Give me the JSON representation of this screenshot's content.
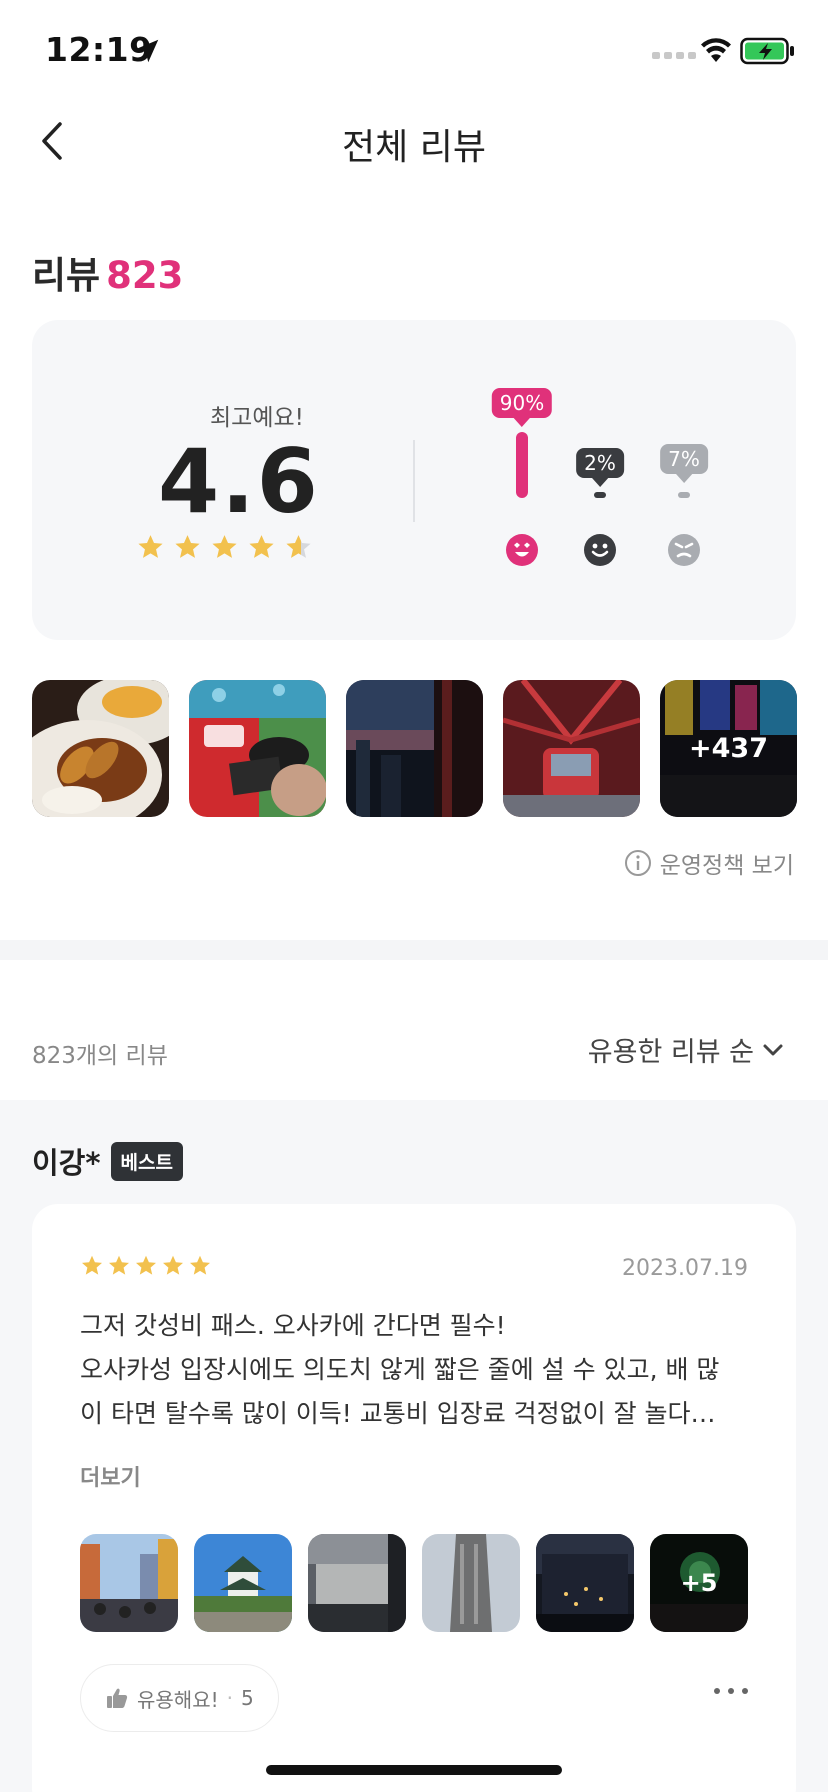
{
  "status_bar": {
    "time": "12:19"
  },
  "nav": {
    "title": "전체 리뷰"
  },
  "reviews_heading": {
    "label": "리뷰",
    "count": "823"
  },
  "summary": {
    "label": "최고예요!",
    "score": "4.6",
    "rating_stars": 4.6,
    "distribution": [
      {
        "key": "best",
        "percent_label": "90%",
        "percent": 90,
        "color": "#e0317a"
      },
      {
        "key": "neutral",
        "percent_label": "2%",
        "percent": 2,
        "color": "#3a3c40"
      },
      {
        "key": "bad",
        "percent_label": "7%",
        "percent": 7,
        "color": "#a9acb1"
      }
    ]
  },
  "photo_strip": {
    "more_label": "+437",
    "photos": [
      "food",
      "vr-booth",
      "night-window",
      "ferris-wheel",
      "dotonbori-signs"
    ]
  },
  "policy_link": {
    "label": "운영정책 보기"
  },
  "list_header": {
    "total": "823개의 리뷰",
    "sort_label": "유용한 리뷰 순"
  },
  "review": {
    "reviewer": "이강*",
    "badge": "베스트",
    "stars": 5,
    "date": "2023.07.19",
    "lines": [
      "그저 갓성비 패스. 오사카에 간다면 필수!",
      "오사카성 입장시에도 의도치 않게 짧은 줄에 설 수 있고, 배 많",
      "이 타면 탈수록 많이 이득! 교통비 입장료 걱정없이 잘 놀다…"
    ],
    "more_label": "더보기",
    "photos": [
      "street",
      "castle",
      "observatory",
      "tower",
      "night-city",
      "green-lights"
    ],
    "photos_more_label": "+5",
    "helpful_label": "유용해요!",
    "helpful_sep": "·",
    "helpful_count": "5"
  },
  "colors": {
    "accent": "#e0317a",
    "star": "#f2c14e",
    "star_empty": "#d6d8dc"
  }
}
